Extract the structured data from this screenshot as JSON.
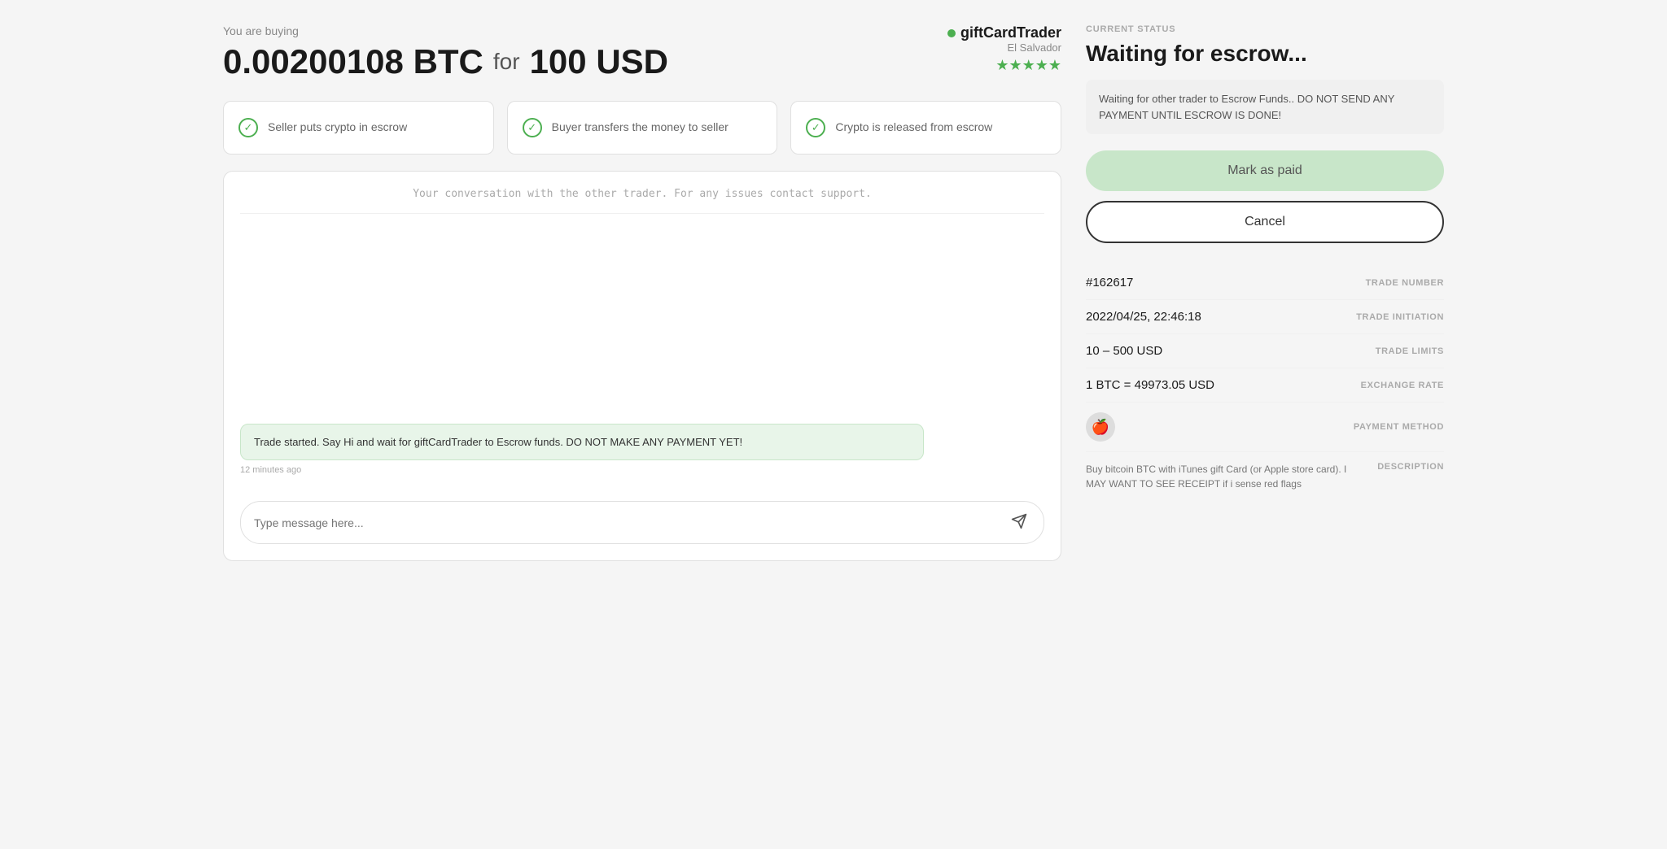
{
  "header": {
    "buying_label": "You are buying",
    "crypto_amount": "0.00200108 BTC",
    "for_word": "for",
    "fiat_amount": "100 USD"
  },
  "trader": {
    "name": "giftCardTrader",
    "location": "El Salvador",
    "stars": "★★★★★"
  },
  "steps": [
    {
      "label": "Seller puts crypto in escrow",
      "active": true
    },
    {
      "label": "Buyer transfers the money to seller",
      "active": true
    },
    {
      "label": "Crypto is released from escrow",
      "active": true
    }
  ],
  "chat": {
    "header_text": "Your conversation with the other trader. For any issues contact support.",
    "message": "Trade started. Say Hi and wait for giftCardTrader to Escrow funds. DO NOT MAKE ANY PAYMENT YET!",
    "time": "12 minutes ago",
    "input_placeholder": "Type message here..."
  },
  "status": {
    "label": "CURRENT STATUS",
    "title": "Waiting for escrow...",
    "warning": "Waiting for other trader to Escrow Funds.. DO NOT SEND ANY PAYMENT UNTIL ESCROW IS DONE!",
    "mark_paid_label": "Mark as paid",
    "cancel_label": "Cancel"
  },
  "trade_details": {
    "trade_number_label": "TRADE NUMBER",
    "trade_number_value": "#162617",
    "trade_initiation_label": "TRADE INITIATION",
    "trade_initiation_value": "2022/04/25, 22:46:18",
    "trade_limits_label": "TRADE LIMITS",
    "trade_limits_value": "10 – 500 USD",
    "exchange_rate_label": "EXCHANGE RATE",
    "exchange_rate_value": "1 BTC = 49973.05 USD",
    "payment_method_label": "PAYMENT METHOD",
    "payment_icon": "🍎",
    "description_label": "DESCRIPTION",
    "description_text": "Buy bitcoin BTC with iTunes gift Card (or Apple store card). I MAY WANT TO SEE RECEIPT if i sense red flags"
  }
}
